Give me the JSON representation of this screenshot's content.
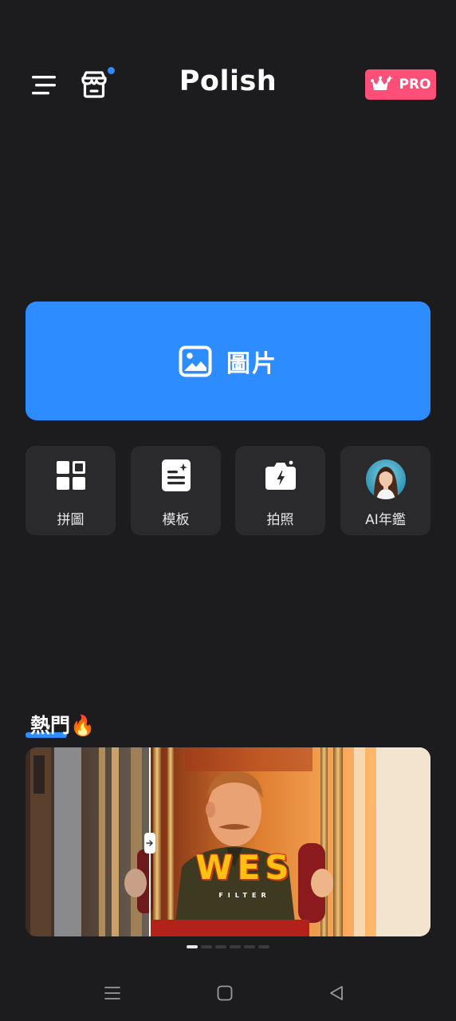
{
  "header": {
    "title": "Polish",
    "pro_label": "PRO",
    "menu_icon": "hamburger-menu-icon",
    "store_icon": "store-icon",
    "store_has_notification": true
  },
  "main_action": {
    "label": "圖片",
    "icon": "image-icon"
  },
  "tools": [
    {
      "label": "拼圖",
      "icon": "collage-grid-icon"
    },
    {
      "label": "模板",
      "icon": "template-icon"
    },
    {
      "label": "拍照",
      "icon": "camera-icon"
    },
    {
      "label": "AI年鑑",
      "icon": "ai-yearbook-avatar"
    }
  ],
  "hot": {
    "title": "熱門🔥",
    "banner": {
      "title": "WES",
      "subtitle": "FILTER"
    },
    "pager": {
      "count": 6,
      "active_index": 0
    }
  },
  "system_nav": {
    "items": [
      "recent-apps-icon",
      "home-icon",
      "back-icon"
    ]
  },
  "colors": {
    "background": "#1c1c1e",
    "accent_blue": "#2d8cff",
    "pro_pink": "#ff4f78",
    "tile": "#2a2a2d"
  }
}
